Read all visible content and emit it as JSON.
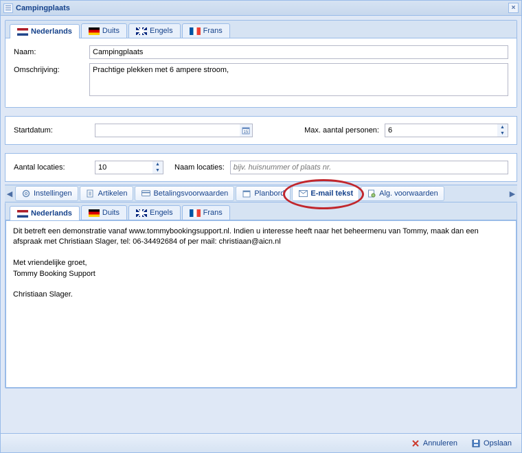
{
  "window": {
    "title": "Campingplaats"
  },
  "langTabs": {
    "nl": "Nederlands",
    "de": "Duits",
    "en": "Engels",
    "fr": "Frans"
  },
  "form": {
    "naam_label": "Naam:",
    "naam_value": "Campingplaats",
    "omschrijving_label": "Omschrijving:",
    "omschrijving_value": "Prachtige plekken met 6 ampere stroom,",
    "startdatum_label": "Startdatum:",
    "startdatum_value": "",
    "maxpersonen_label": "Max. aantal personen:",
    "maxpersonen_value": "6",
    "aantal_locaties_label": "Aantal locaties:",
    "aantal_locaties_value": "10",
    "naam_locaties_label": "Naam locaties:",
    "naam_locaties_placeholder": "bijv. huisnummer of plaats nr."
  },
  "toolbar": {
    "instellingen": "Instellingen",
    "artikelen": "Artikelen",
    "betalingsvoorwaarden": "Betalingsvoorwaarden",
    "planbord": "Planbord",
    "email_tekst": "E-mail tekst",
    "alg_voorwaarden": "Alg. voorwaarden"
  },
  "email_text": "Dit betreft een demonstratie vanaf www.tommybookingsupport.nl. Indien u interesse heeft naar het beheermenu van Tommy, maak dan een afspraak met Christiaan Slager, tel: 06-34492684 of per mail: christiaan@aicn.nl\n\nMet vriendelijke groet,\nTommy Booking Support\n\nChristiaan Slager.",
  "footer": {
    "annuleren": "Annuleren",
    "opslaan": "Opslaan"
  }
}
